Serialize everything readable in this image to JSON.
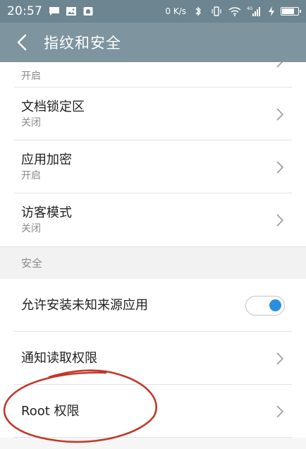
{
  "status_bar": {
    "time": "20:57",
    "net_speed": "0 K/s",
    "network_type": "4G",
    "icons": [
      "message-icon",
      "image-icon",
      "notification-app-icon",
      "bluetooth-icon",
      "vibrate-icon",
      "wifi-icon",
      "signal-icon",
      "charging-icon",
      "battery-icon"
    ]
  },
  "header": {
    "title": "指纹和安全",
    "back_icon": "back-arrow-icon"
  },
  "list": {
    "partial_item": {
      "subtitle": "开启"
    },
    "items": [
      {
        "title": "文档锁定区",
        "subtitle": "关闭"
      },
      {
        "title": "应用加密",
        "subtitle": "开启"
      },
      {
        "title": "访客模式",
        "subtitle": "关闭"
      }
    ]
  },
  "security_section": {
    "header": "安全",
    "items": [
      {
        "title": "允许安装未知来源应用",
        "control": "toggle",
        "toggle_on": true
      },
      {
        "title": "通知读取权限",
        "control": "chevron"
      },
      {
        "title": "Root 权限",
        "control": "chevron"
      }
    ]
  },
  "colors": {
    "status_bar": "#6d8590",
    "title_bar": "#7e949e",
    "toggle_accent": "#2b8fe0",
    "annotation_stroke": "#c0392b"
  }
}
